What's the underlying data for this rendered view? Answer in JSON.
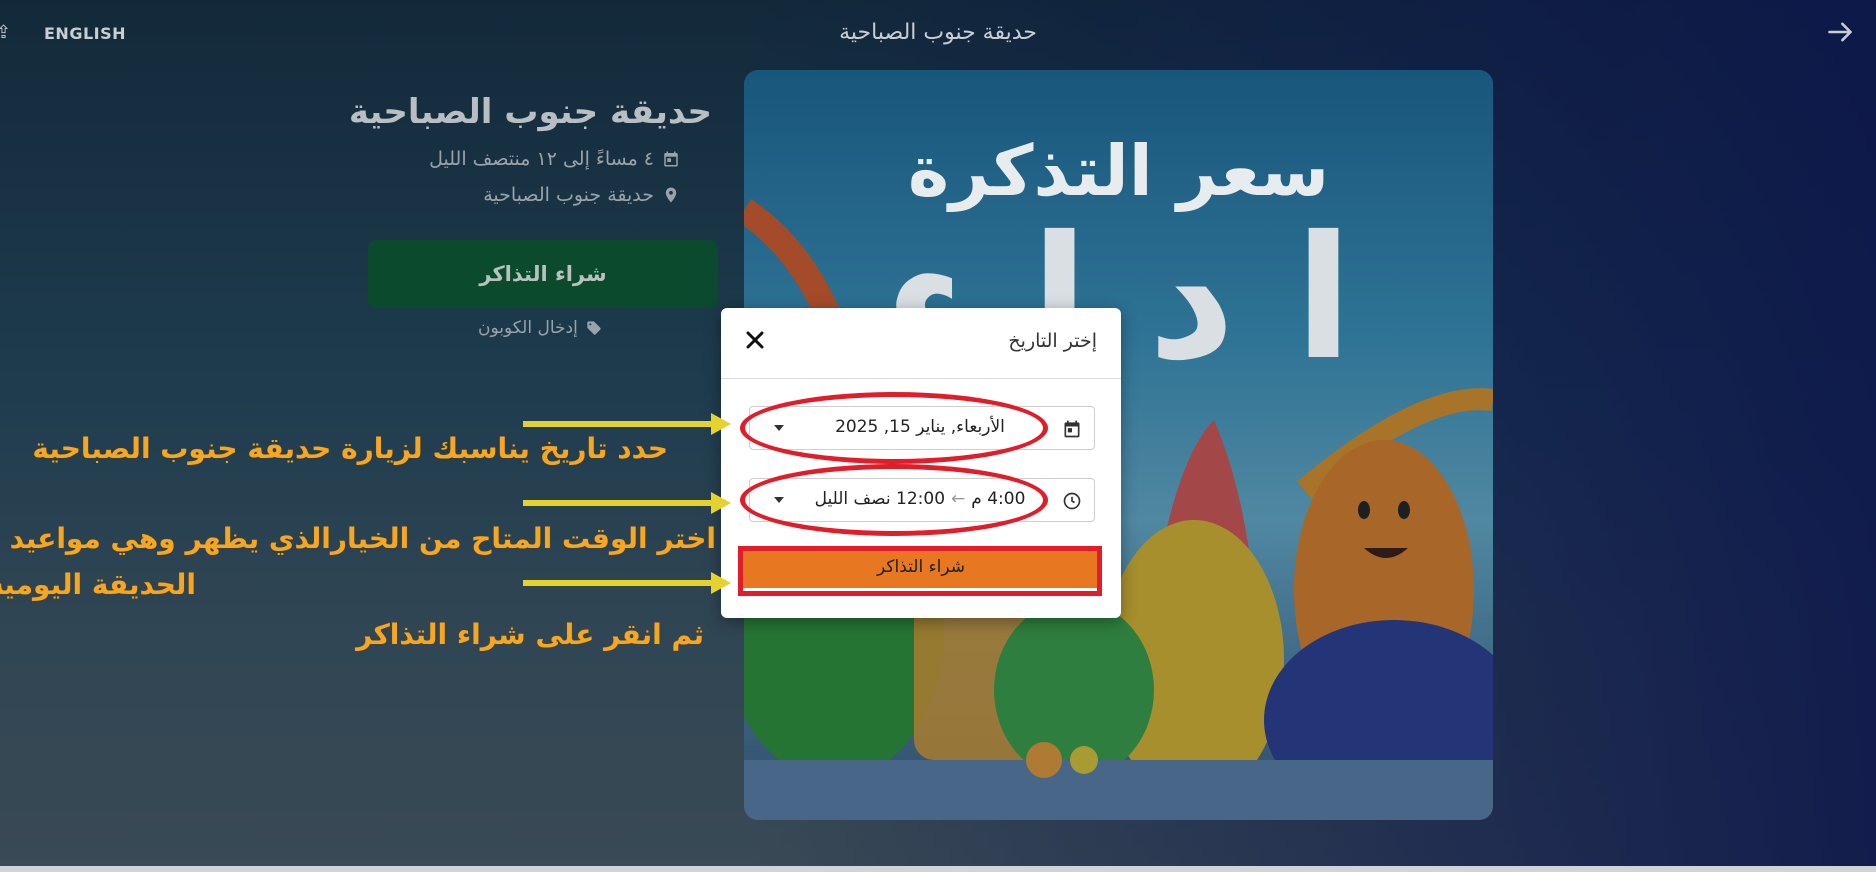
{
  "header": {
    "language_link": "ENGLISH",
    "title": "حديقة جنوب الصباحية"
  },
  "event": {
    "title": "حديقة جنوب الصباحية",
    "time": "٤ مساءً إلى ١٢ منتصف الليل",
    "location": "حديقة جنوب الصباحية",
    "buy_label": "شراء التذاكر",
    "coupon_label": "إدخال الكوبون"
  },
  "poster": {
    "heading": "سعر التذكرة",
    "big_text": "ا د ا ﺀ"
  },
  "modal": {
    "title": "إختر التاريخ",
    "date_value": "الأربعاء, يناير 15, 2025",
    "time_start": "4:00 م",
    "time_end": "12:00 نصف الليل",
    "buy_label": "شراء التذاكر"
  },
  "annotations": {
    "note_date": "حدد تاريخ يناسبك لزيارة حديقة جنوب الصباحية",
    "note_time_line1": "اختر الوقت المتاح من الخيارالذي يظهر وهي مواعيد افتتاح",
    "note_time_line2": "الحديقة اليومية",
    "note_buy": "ثم انقر على شراء التذاكر",
    "highlight_color": "#e11d2a",
    "arrow_color": "#e6d22c",
    "note_color": "#f5a623"
  }
}
